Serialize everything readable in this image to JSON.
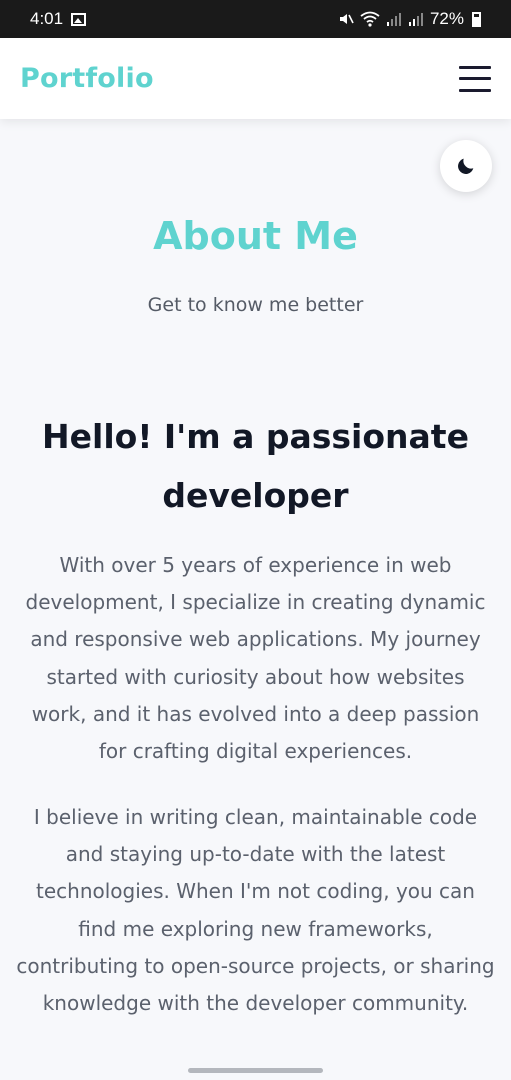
{
  "status_bar": {
    "time": "4:01",
    "battery": "72%",
    "icons": [
      "gallery-icon",
      "mute-icon",
      "wifi-icon",
      "signal-icon",
      "signal-icon",
      "battery-icon"
    ]
  },
  "navbar": {
    "brand": "Portfolio",
    "menu_icon": "hamburger-menu-icon"
  },
  "theme_toggle": {
    "icon": "moon-icon"
  },
  "about": {
    "title": "About Me",
    "subtitle": "Get to know me better",
    "headline": "Hello! I'm a passionate developer",
    "paragraphs": [
      "With over 5 years of experience in web development, I specialize in creating dynamic and responsive web applications. My journey started with curiosity about how websites work, and it has evolved into a deep passion for crafting digital experiences.",
      "I believe in writing clean, maintainable code and staying up-to-date with the latest technologies. When I'm not coding, you can find me exploring new frameworks, contributing to open-source projects, or sharing knowledge with the developer community."
    ]
  },
  "colors": {
    "accent": "#5fd3cf",
    "heading": "#121826",
    "body_text": "#5b616d",
    "background": "#f7f8fb"
  }
}
